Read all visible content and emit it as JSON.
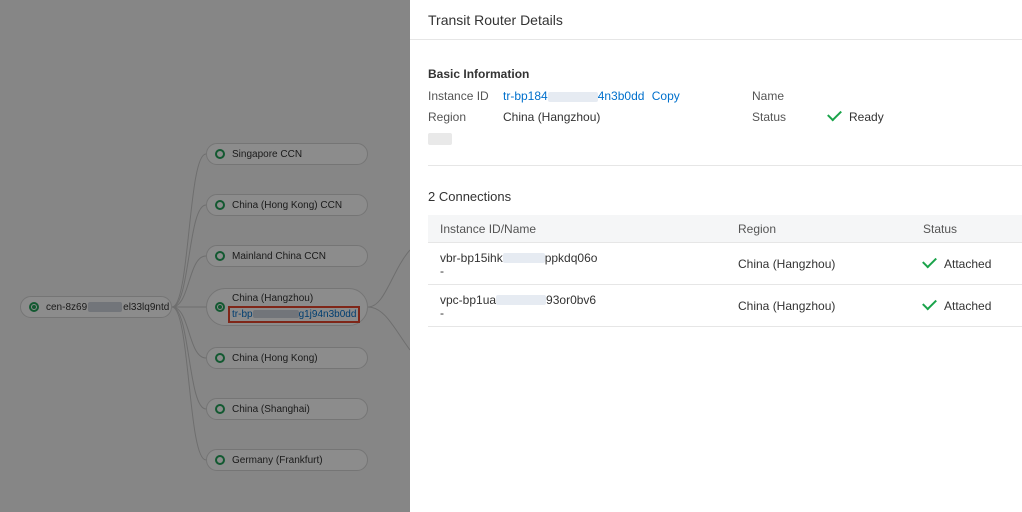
{
  "topology": {
    "root": {
      "label": "cen-8z69",
      "label_suffix": "el33lq9ntd"
    },
    "nodes": [
      {
        "label": "Singapore CCN"
      },
      {
        "label": "China (Hong Kong) CCN"
      },
      {
        "label": "Mainland China CCN"
      },
      {
        "label": "China (Hangzhou)",
        "link_prefix": "tr-bp",
        "link_suffix": "g1j94n3b0dd"
      },
      {
        "label": "China (Hong Kong)"
      },
      {
        "label": "China (Shanghai)"
      },
      {
        "label": "Germany (Frankfurt)"
      }
    ]
  },
  "panel": {
    "title": "Transit Router Details",
    "basic_info_title": "Basic Information",
    "instance_id_label": "Instance ID",
    "instance_id_prefix": "tr-bp184",
    "instance_id_suffix": "4n3b0dd",
    "copy_label": "Copy",
    "name_label": "Name",
    "region_label": "Region",
    "region_value": "China (Hangzhou)",
    "status_label": "Status",
    "status_value": "Ready",
    "connections_title": "2 Connections",
    "table": {
      "headers": [
        "Instance ID/Name",
        "Region",
        "Status"
      ],
      "rows": [
        {
          "id_prefix": "vbr-bp15ihk",
          "id_suffix": "ppkdq06o",
          "name": "-",
          "region": "China (Hangzhou)",
          "status": "Attached"
        },
        {
          "id_prefix": "vpc-bp1ua",
          "id_suffix": "93or0bv6",
          "name": "-",
          "region": "China (Hangzhou)",
          "status": "Attached"
        }
      ]
    }
  },
  "colors": {
    "accent": "#0070cc",
    "success": "#1aa34a",
    "highlight": "#e8452c"
  }
}
